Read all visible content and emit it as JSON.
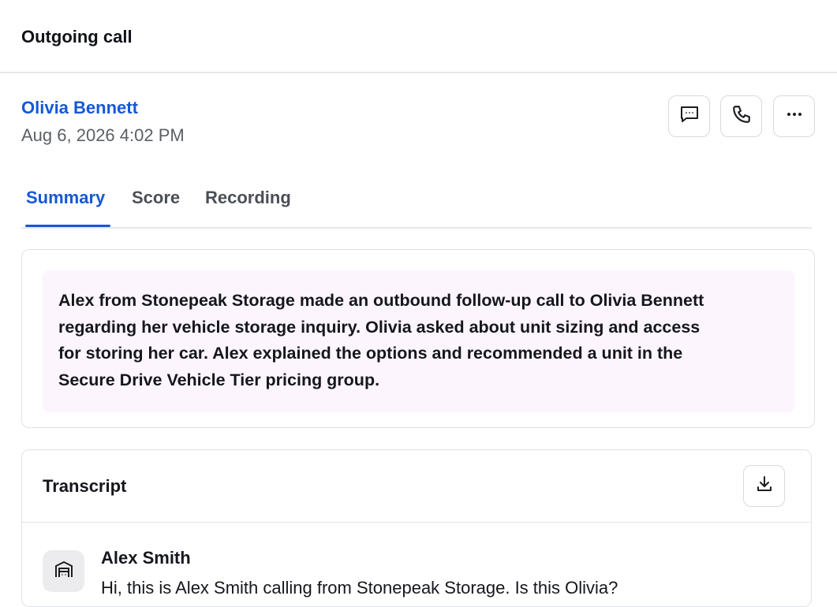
{
  "header": {
    "title": "Outgoing call"
  },
  "contact": {
    "name": "Olivia Bennett",
    "datetime": "Aug 6, 2026 4:02 PM"
  },
  "actions": [
    {
      "name": "message-icon"
    },
    {
      "name": "phone-icon"
    },
    {
      "name": "more-icon"
    }
  ],
  "tabs": [
    {
      "label": "Summary",
      "active": true
    },
    {
      "label": "Score",
      "active": false
    },
    {
      "label": "Recording",
      "active": false
    }
  ],
  "summary": {
    "lines": [
      "Alex from Stonepeak Storage made an outbound follow-up call to Olivia Bennett",
      "regarding her vehicle storage inquiry. Olivia asked about unit sizing and access",
      "for storing her car. Alex explained the options and recommended a unit in the",
      "Secure Drive Vehicle Tier pricing group."
    ]
  },
  "transcript": {
    "title": "Transcript",
    "download_icon": "download-icon",
    "entries": [
      {
        "speaker": "Alex Smith",
        "avatar_icon": "storefront-icon",
        "text": "Hi, this is Alex Smith calling from Stonepeak Storage. Is this Olivia?"
      }
    ]
  },
  "colors": {
    "accent": "#1558d6",
    "summary_bg": "#fcf5fd"
  }
}
